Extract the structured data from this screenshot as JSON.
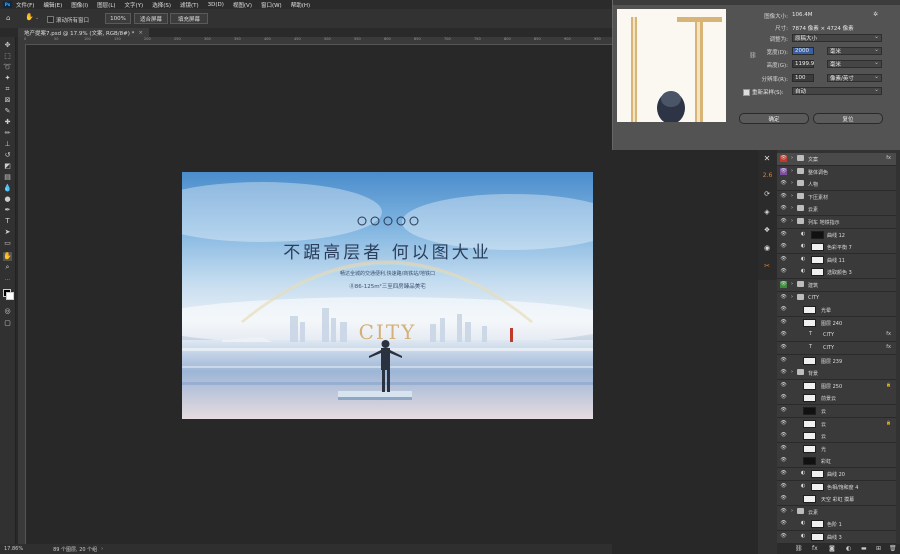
{
  "menu": [
    "文件(F)",
    "编辑(E)",
    "图像(I)",
    "图层(L)",
    "文字(Y)",
    "选择(S)",
    "滤镜(T)",
    "3D(D)",
    "视图(V)",
    "窗口(W)",
    "帮助(H)"
  ],
  "options": {
    "scroll_all_label": "滚动所有窗口",
    "zoom_value": "100%",
    "fit_screen_label": "适合屏幕",
    "fill_screen_label": "填充屏幕"
  },
  "document": {
    "tab_label": "地产提案7.psd @ 17.9% (文案, RGB/8#) *",
    "ruler_ticks": [
      "0",
      "50",
      "100",
      "150",
      "200",
      "250",
      "300",
      "350",
      "400",
      "450",
      "500",
      "550",
      "600",
      "650",
      "700",
      "750",
      "800",
      "850",
      "900",
      "950"
    ]
  },
  "artwork": {
    "headline": "不踞高层者  何以图大业",
    "subline1": "畅达全城的交通便利,快速路/商铁站/地铁口",
    "subline2": "⓪86-125m²三至四房臻品美宅",
    "city_text": "CITY",
    "icon_tags": [
      "",
      "",
      "",
      "",
      ""
    ]
  },
  "status": {
    "zoom": "17.86%",
    "info": "89 个图层, 20 个组"
  },
  "dialog": {
    "image_size_label": "图像大小:",
    "image_size_value": "106.4M",
    "dimensions_label": "尺寸:",
    "dimensions_value": "7874 像素 × 4724 像素",
    "adjust_label": "调整为:",
    "adjust_value": "原稿大小",
    "width_label": "宽度(D):",
    "width_value": "2000",
    "width_unit": "毫米",
    "height_label": "高度(G):",
    "height_value": "1199.9",
    "height_unit": "毫米",
    "resolution_label": "分辨率(R):",
    "resolution_value": "100",
    "resolution_unit": "像素/英寸",
    "resample_label": "重新采样(S):",
    "resample_value": "自动",
    "ok_label": "确定",
    "reset_label": "复位"
  },
  "layers": [
    {
      "name": "文案",
      "kind": "folder",
      "indent": 0,
      "selected": true,
      "fx": true,
      "eye_color": "#c0392b"
    },
    {
      "name": "整体调色",
      "kind": "folder",
      "indent": 0,
      "eye_color": "#7b4f9e"
    },
    {
      "name": "人物",
      "kind": "folder",
      "indent": 0
    },
    {
      "name": "下压素材",
      "kind": "folder",
      "indent": 0
    },
    {
      "name": "云素",
      "kind": "folder",
      "indent": 0
    },
    {
      "name": "列车   地铁指示",
      "kind": "folder",
      "indent": 0
    },
    {
      "name": "曲线 12",
      "kind": "adj",
      "indent": 1,
      "dark": true
    },
    {
      "name": "色彩平衡 7",
      "kind": "adj",
      "indent": 1
    },
    {
      "name": "曲线 11",
      "kind": "adj",
      "indent": 1
    },
    {
      "name": "选取颜色 3",
      "kind": "adj",
      "indent": 1
    },
    {
      "name": "建筑",
      "kind": "folder",
      "indent": 0,
      "eye_color": "#3c8a3c"
    },
    {
      "name": "CITY",
      "kind": "folder",
      "indent": 0
    },
    {
      "name": "光晕",
      "kind": "layer",
      "indent": 1
    },
    {
      "name": "图层 240",
      "kind": "layer",
      "indent": 1
    },
    {
      "name": "CITY",
      "kind": "text",
      "indent": 1,
      "fx": true
    },
    {
      "name": "CITY",
      "kind": "text",
      "indent": 1,
      "fx": true
    },
    {
      "name": "图层 239",
      "kind": "layer",
      "indent": 1
    },
    {
      "name": "背景",
      "kind": "folder",
      "indent": 0
    },
    {
      "name": "图层 250",
      "kind": "layer",
      "indent": 1,
      "lock": true
    },
    {
      "name": "前景云",
      "kind": "layer",
      "indent": 1
    },
    {
      "name": "云",
      "kind": "layer",
      "indent": 1,
      "dark": true
    },
    {
      "name": "云",
      "kind": "layer",
      "indent": 1,
      "lock": true
    },
    {
      "name": "云",
      "kind": "layer",
      "indent": 1
    },
    {
      "name": "光",
      "kind": "layer",
      "indent": 1
    },
    {
      "name": "彩虹",
      "kind": "layer",
      "indent": 1,
      "dark": true
    },
    {
      "name": "曲线 20",
      "kind": "adj",
      "indent": 1
    },
    {
      "name": "色相/饱和度 4",
      "kind": "adj",
      "indent": 1
    },
    {
      "name": "天空 彩虹 摸幕",
      "kind": "layer",
      "indent": 1
    },
    {
      "name": "云素",
      "kind": "folder",
      "indent": 0
    },
    {
      "name": "色阶 1",
      "kind": "adj",
      "indent": 1
    },
    {
      "name": "曲线 3",
      "kind": "adj",
      "indent": 1
    }
  ]
}
